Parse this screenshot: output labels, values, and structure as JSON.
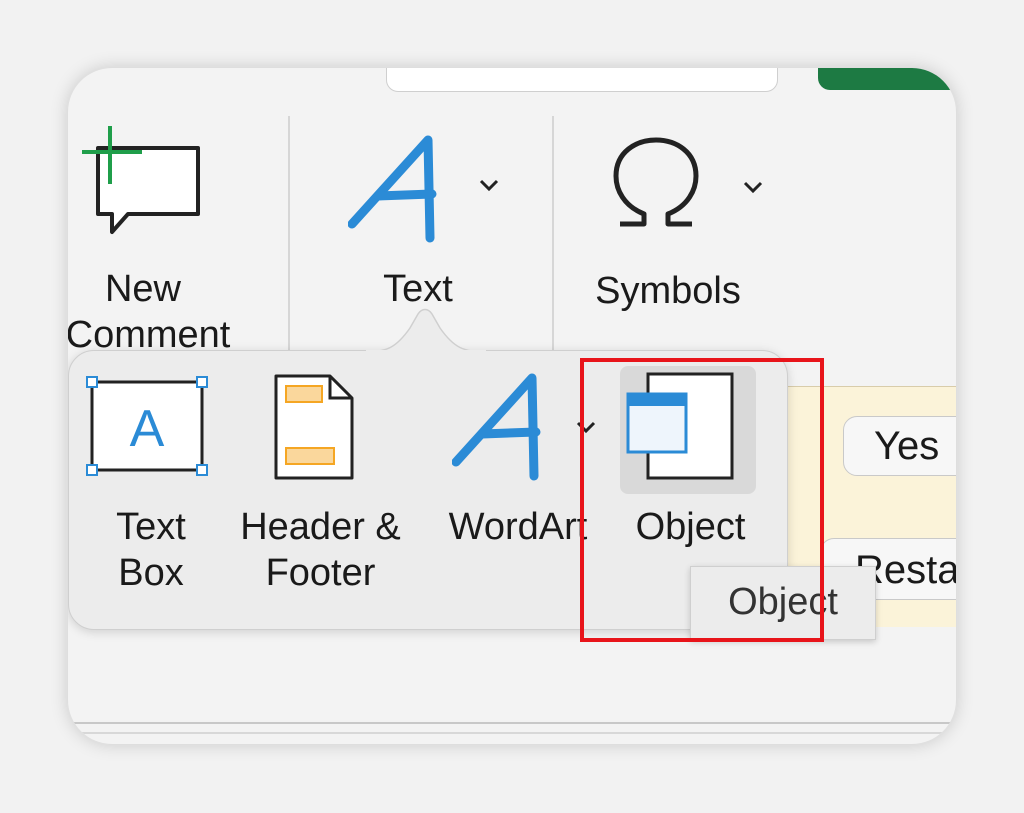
{
  "ribbon": {
    "new_comment": {
      "line1": "New",
      "line2": "Comment",
      "icon": "new-comment-icon"
    },
    "text": {
      "label": "Text",
      "icon": "text-a-icon"
    },
    "symbols": {
      "label": "Symbols",
      "icon": "omega-icon"
    }
  },
  "dropdown": {
    "items": [
      {
        "line1": "Text",
        "line2": "Box",
        "icon": "text-box-icon"
      },
      {
        "line1": "Header &",
        "line2": "Footer",
        "icon": "header-footer-icon"
      },
      {
        "line1": "WordArt",
        "line2": "",
        "icon": "wordart-icon"
      },
      {
        "line1": "Object",
        "line2": "",
        "icon": "object-icon",
        "selected": true
      }
    ]
  },
  "tooltip": {
    "text": "Object"
  },
  "background": {
    "button_yes": "Yes",
    "button_restart": "Resta"
  },
  "colors": {
    "accent_blue": "#2b8bd6",
    "highlight_red": "#e8141a",
    "comment_plus_green": "#1f9e4a",
    "excel_green": "#1d7a43",
    "header_footer_orange": "#f5a623",
    "panel_bg": "#fbf3d9"
  }
}
